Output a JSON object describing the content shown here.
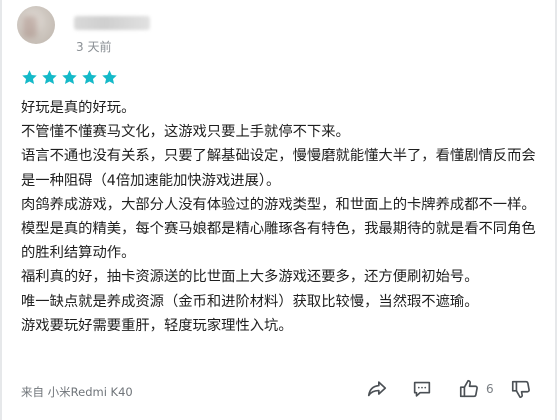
{
  "review": {
    "time": "3 天前",
    "rating": 5,
    "star_color": "#14b9c8",
    "paragraphs": [
      "好玩是真的好玩。",
      "不管懂不懂赛马文化，这游戏只要上手就停不下来。",
      "语言不通也没有关系，只要了解基础设定，慢慢磨就能懂大半了，看懂剧情反而会是一种阻碍（4倍加速能加快游戏进展）。",
      "肉鸽养成游戏，大部分人没有体验过的游戏类型，和世面上的卡牌养成都不一样。",
      "模型是真的精美，每个赛马娘都是精心雕琢各有特色，我最期待的就是看不同角色的胜利结算动作。",
      "福利真的好，抽卡资源送的比世面上大多游戏还要多，还方便刷初始号。",
      "唯一缺点就是养成资源（金币和进阶材料）获取比较慢，当然瑕不遮瑜。",
      "游戏要玩好需要重肝，轻度玩家理性入坑。"
    ],
    "device": "来自 小米Redmi K40",
    "like_count": "6"
  },
  "icons": {
    "star": "star-icon",
    "share": "share-icon",
    "comment": "comment-icon",
    "like": "thumbs-up-icon",
    "dislike": "thumbs-down-icon"
  }
}
